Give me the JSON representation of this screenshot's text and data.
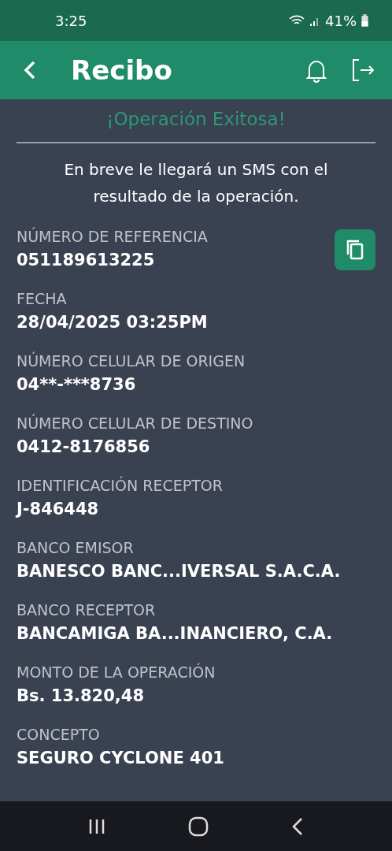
{
  "status_bar": {
    "time": "3:25",
    "battery": "41%"
  },
  "header": {
    "title": "Recibo"
  },
  "result": {
    "title": "¡Operación Exitosa!",
    "message": "En breve le llegará un SMS con el resultado de la operación."
  },
  "fields": [
    {
      "label": "NÚMERO DE REFERENCIA",
      "value": "051189613225",
      "copyable": true
    },
    {
      "label": "FECHA",
      "value": "28/04/2025 03:25PM",
      "copyable": false
    },
    {
      "label": "NÚMERO CELULAR DE ORIGEN",
      "value": "04**-***8736",
      "copyable": false
    },
    {
      "label": "NÚMERO CELULAR DE DESTINO",
      "value": "0412-8176856",
      "copyable": false
    },
    {
      "label": "IDENTIFICACIÓN RECEPTOR",
      "value": "J-846448",
      "copyable": false
    },
    {
      "label": "BANCO EMISOR",
      "value": "BANESCO BANC...IVERSAL S.A.C.A.",
      "copyable": false
    },
    {
      "label": "BANCO RECEPTOR",
      "value": "BANCAMIGA BA...INANCIERO, C.A.",
      "copyable": false
    },
    {
      "label": "MONTO DE LA OPERACIÓN",
      "value": "Bs. 13.820,48",
      "copyable": false
    },
    {
      "label": "CONCEPTO",
      "value": "SEGURO CYCLONE 401",
      "copyable": false
    }
  ]
}
